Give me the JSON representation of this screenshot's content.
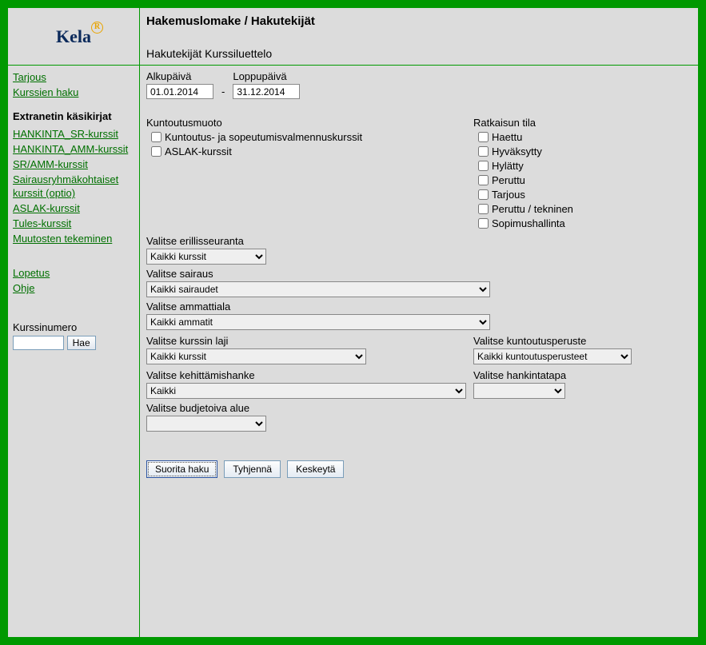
{
  "logo": {
    "text": "Kela",
    "reg": "R"
  },
  "header": {
    "title": "Hakemuslomake / Hakutekijät",
    "subtitle": "Hakutekijät Kurssiluettelo"
  },
  "sidebar": {
    "top_links": [
      "Tarjous",
      "Kurssien haku"
    ],
    "heading": "Extranetin käsikirjat",
    "manual_links": [
      "HANKINTA_SR-kurssit",
      "HANKINTA_AMM-kurssit",
      "SR/AMM-kurssit",
      "Sairausryhmäkohtaiset kurssit (optio)",
      "ASLAK-kurssit",
      "Tules-kurssit",
      "Muutosten tekeminen"
    ],
    "util_links": [
      "Lopetus",
      "Ohje"
    ],
    "kurssinumero_label": "Kurssinumero",
    "kurssinumero_value": "",
    "hae_label": "Hae"
  },
  "dates": {
    "start_label": "Alkupäivä",
    "start_value": "01.01.2014",
    "end_label": "Loppupäivä",
    "end_value": "31.12.2014",
    "sep": "-"
  },
  "kuntoutusmuoto": {
    "label": "Kuntoutusmuoto",
    "options": [
      "Kuntoutus- ja sopeutumisvalmennuskurssit",
      "ASLAK-kurssit"
    ]
  },
  "ratkaisun_tila": {
    "label": "Ratkaisun tila",
    "options": [
      "Haettu",
      "Hyväksytty",
      "Hylätty",
      "Peruttu",
      "Tarjous",
      "Peruttu / tekninen",
      "Sopimushallinta"
    ]
  },
  "selects": {
    "erillisseuranta": {
      "label": "Valitse erillisseuranta",
      "value": "Kaikki kurssit"
    },
    "sairaus": {
      "label": "Valitse sairaus",
      "value": "Kaikki sairaudet"
    },
    "ammattiala": {
      "label": "Valitse ammattiala",
      "value": "Kaikki ammatit"
    },
    "kurssin_laji": {
      "label": "Valitse kurssin laji",
      "value": "Kaikki kurssit"
    },
    "kuntoutusperuste": {
      "label": "Valitse kuntoutusperuste",
      "value": "Kaikki kuntoutusperusteet"
    },
    "kehittamishanke": {
      "label": "Valitse kehittämishanke",
      "value": "Kaikki"
    },
    "hankintatapa": {
      "label": "Valitse hankintatapa",
      "value": ""
    },
    "budjetoiva_alue": {
      "label": "Valitse budjetoiva alue",
      "value": ""
    }
  },
  "buttons": {
    "search": "Suorita haku",
    "clear": "Tyhjennä",
    "cancel": "Keskeytä"
  }
}
